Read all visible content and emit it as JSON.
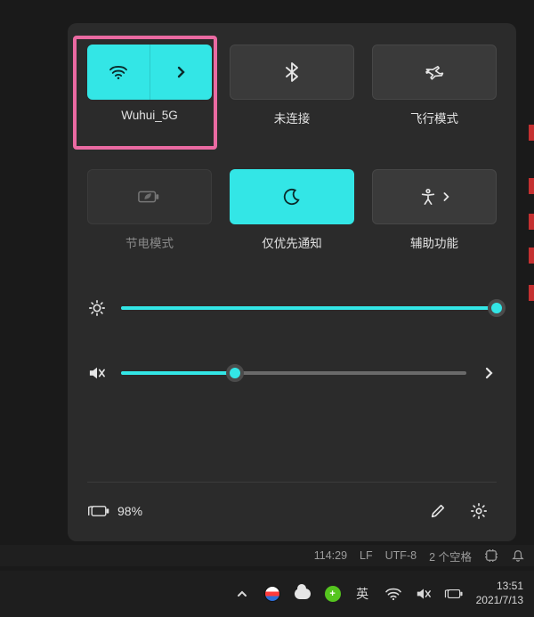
{
  "colors": {
    "accent": "#33e6e6",
    "highlight": "#ea6aa2"
  },
  "tiles": {
    "wifi": {
      "label": "Wuhui_5G",
      "active": true,
      "has_expand": true
    },
    "bluetooth": {
      "label": "未连接",
      "active": false
    },
    "airplane": {
      "label": "飞行模式",
      "active": false
    },
    "battery_saver": {
      "label": "节电模式",
      "enabled": false
    },
    "focus": {
      "label": "仅优先通知",
      "active": true
    },
    "accessibility": {
      "label": "辅助功能",
      "active": false,
      "has_expand": true
    }
  },
  "sliders": {
    "brightness": {
      "value": 100
    },
    "volume": {
      "value": 33,
      "muted": true,
      "has_expand": true
    }
  },
  "battery": {
    "percent_text": "98%"
  },
  "statusbar": {
    "time": "114:29",
    "eol": "LF",
    "encoding": "UTF-8",
    "spaces": "2 个空格"
  },
  "taskbar": {
    "ime": "英",
    "green_badge": "+",
    "clock": {
      "time": "13:51",
      "date": "2021/7/13"
    }
  }
}
